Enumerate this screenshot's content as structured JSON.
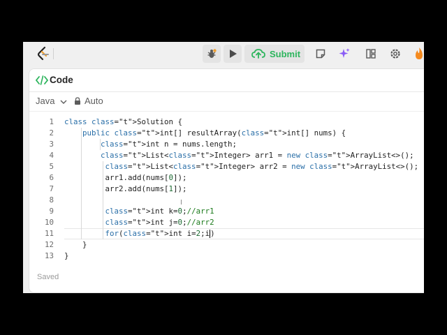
{
  "toolbar": {
    "submit_label": "Submit"
  },
  "code_panel": {
    "title": "Code",
    "language": "Java",
    "mode": "Auto",
    "status": "Saved"
  },
  "editor": {
    "line_numbers": [
      "1",
      "2",
      "3",
      "4",
      "5",
      "6",
      "7",
      "8",
      "9",
      "10",
      "11",
      "12",
      "13"
    ],
    "lines": [
      "class Solution {",
      "    public int[] resultArray(int[] nums) {",
      "        int n = nums.length;",
      "        List<Integer> arr1 = new ArrayList<>();",
      "         List<Integer> arr2 = new ArrayList<>();",
      "         arr1.add(nums[0]);",
      "         arr2.add(nums[1]);",
      "",
      "         int k=0;//arr1",
      "         int j=0;//arr2",
      "         for(int i=2;i)",
      "    }",
      "}"
    ]
  },
  "colors": {
    "accent_green": "#2db55d",
    "keyword": "#2a6fa8",
    "type": "#0a8a8a",
    "ai_icon": "#8a5cf6",
    "streak_icon": "#f58a1f"
  },
  "icons": [
    "leetcode-logo",
    "debug-icon",
    "run-icon",
    "cloud-upload-icon",
    "note-icon",
    "sparkle-icon",
    "layout-icon",
    "gear-icon",
    "fire-icon",
    "code-icon",
    "chevron-down-icon",
    "lock-icon"
  ]
}
